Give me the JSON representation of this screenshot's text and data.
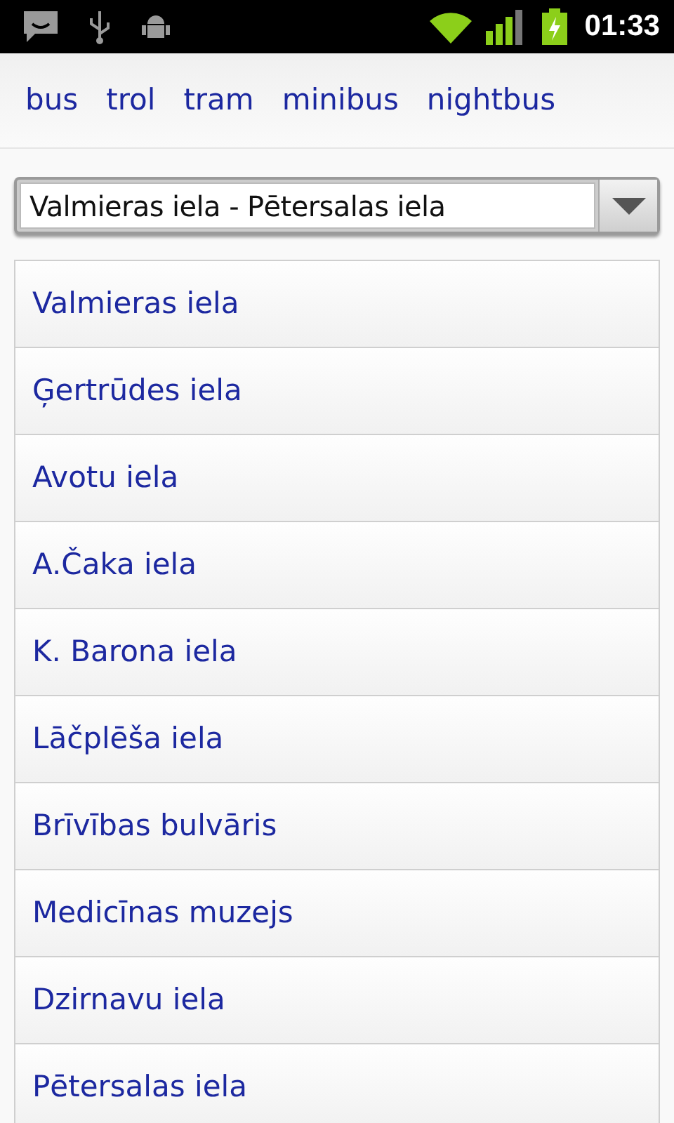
{
  "status_bar": {
    "time": "01:33"
  },
  "tabs": [
    {
      "label": "bus"
    },
    {
      "label": "trol"
    },
    {
      "label": "tram"
    },
    {
      "label": "minibus"
    },
    {
      "label": "nightbus"
    }
  ],
  "route_select": {
    "value": "Valmieras iela - Pētersalas iela"
  },
  "stops": [
    {
      "name": "Valmieras iela"
    },
    {
      "name": "Ģertrūdes iela"
    },
    {
      "name": "Avotu iela"
    },
    {
      "name": "A.Čaka iela"
    },
    {
      "name": "K. Barona iela"
    },
    {
      "name": "Lāčplēša iela"
    },
    {
      "name": "Brīvības bulvāris"
    },
    {
      "name": "Medicīnas muzejs"
    },
    {
      "name": "Dzirnavu iela"
    },
    {
      "name": "Pētersalas iela"
    }
  ]
}
